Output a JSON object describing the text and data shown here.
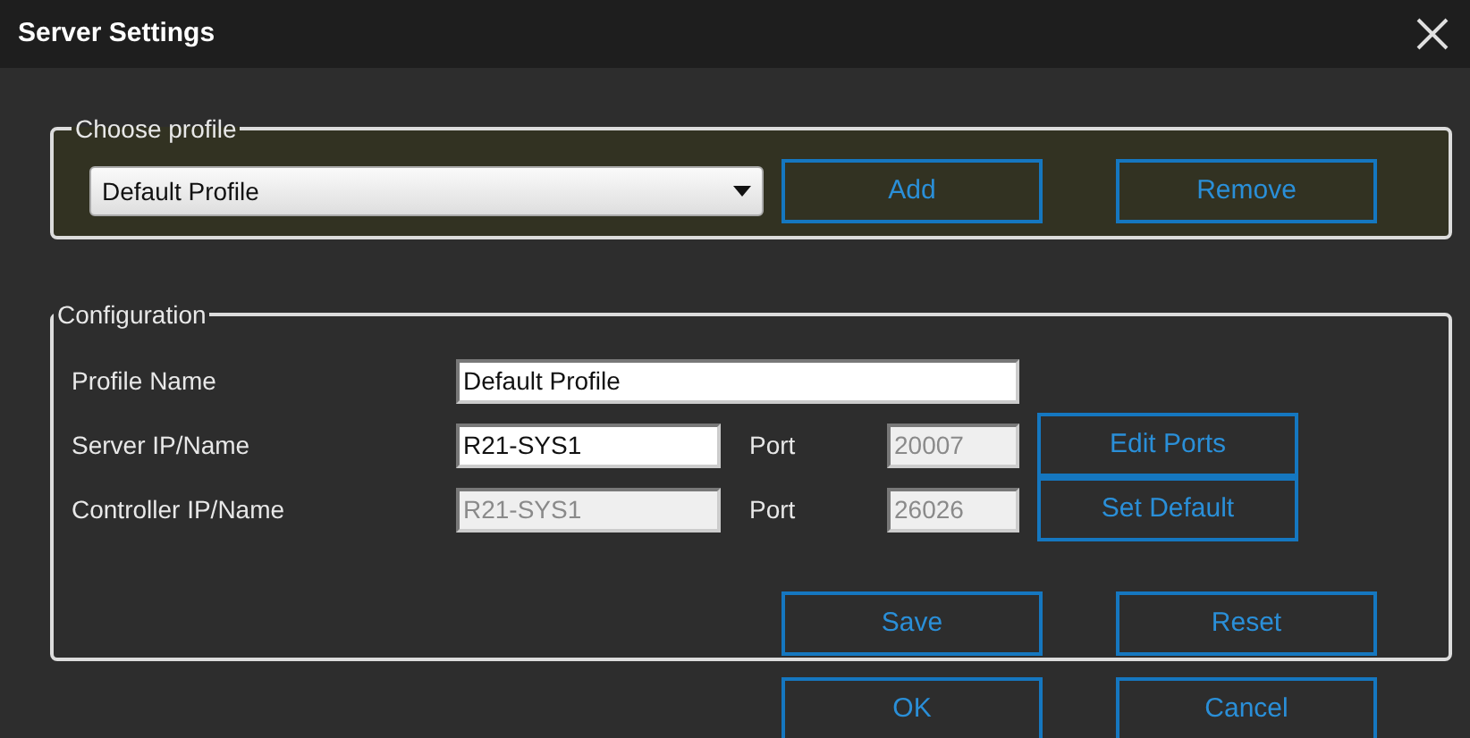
{
  "window": {
    "title": "Server Settings"
  },
  "profile_group": {
    "legend": "Choose profile",
    "selected_profile": "Default Profile",
    "buttons": [
      "Add",
      "Remove"
    ]
  },
  "configuration": {
    "legend": "Configuration",
    "fields": [
      {
        "label": "Profile Name",
        "value": "Default Profile",
        "disabled": false
      },
      {
        "label": "Server IP/Name",
        "value": "R21-SYS1",
        "disabled": false,
        "port_label": "Port",
        "port": "20007",
        "port_disabled": true,
        "action": "Edit Ports"
      },
      {
        "label": "Controller IP/Name",
        "value": "R21-SYS1",
        "disabled": true,
        "port_label": "Port",
        "port": "26026",
        "port_disabled": true,
        "action": "Set Default"
      }
    ],
    "buttons": [
      "Save",
      "Reset"
    ]
  },
  "footer_buttons": [
    "OK",
    "Cancel"
  ]
}
